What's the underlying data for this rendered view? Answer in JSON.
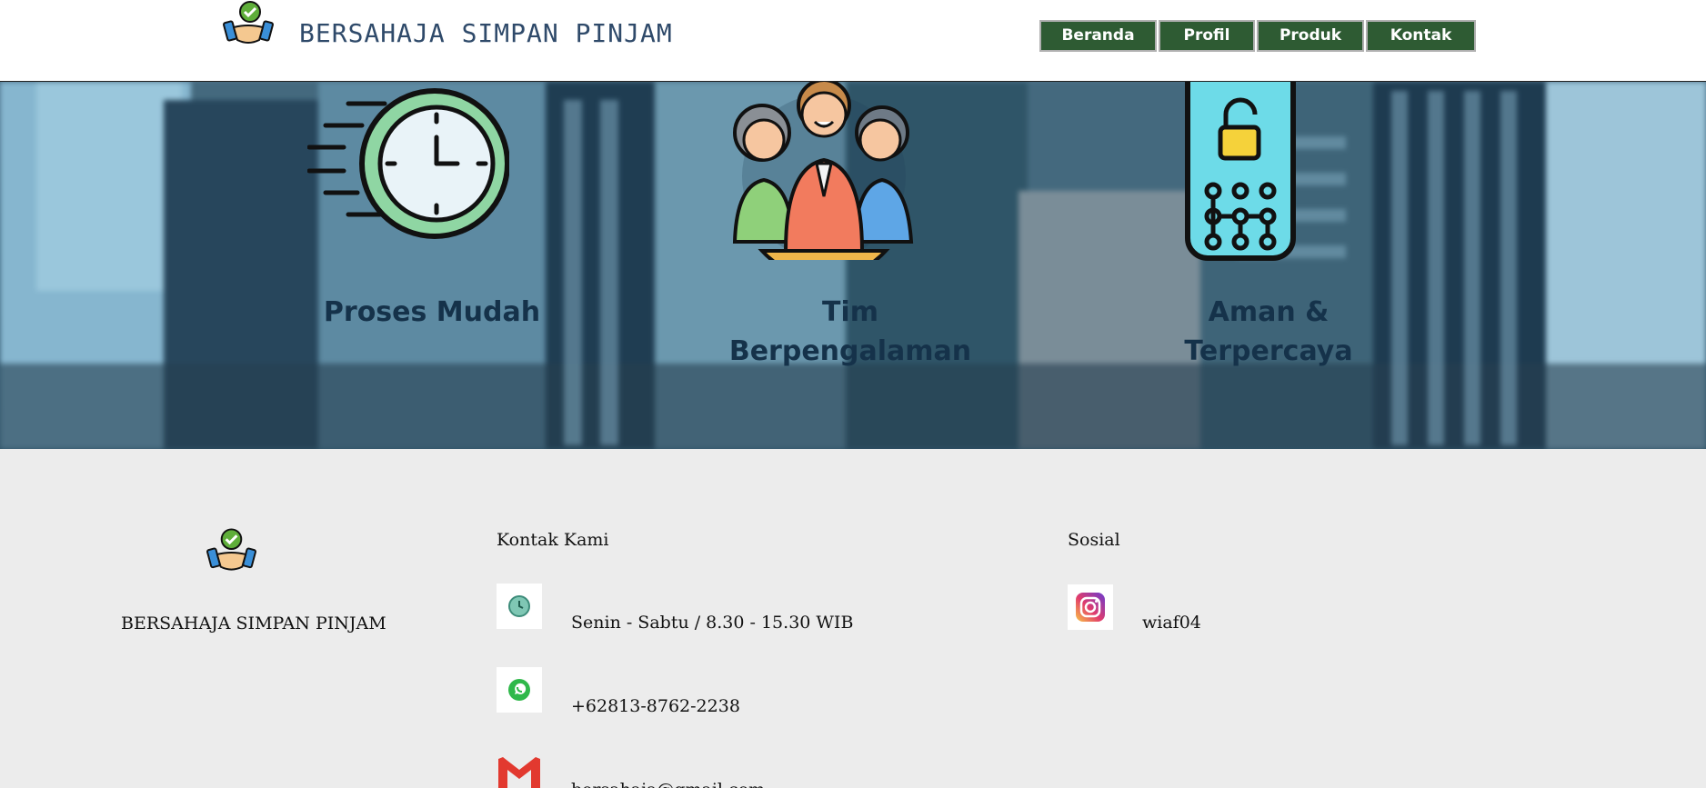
{
  "header": {
    "brand": "BERSAHAJA SIMPAN PINJAM",
    "nav": [
      {
        "label": "Beranda"
      },
      {
        "label": "Profil"
      },
      {
        "label": "Produk"
      },
      {
        "label": "Kontak"
      }
    ]
  },
  "features": [
    {
      "icon": "clock-icon",
      "line1": "Proses Mudah",
      "line2": ""
    },
    {
      "icon": "team-icon",
      "line1": "Tim",
      "line2": "Berpengalaman"
    },
    {
      "icon": "security-lock-icon",
      "line1": "Aman &",
      "line2": "Terpercaya"
    }
  ],
  "footer": {
    "brand": "BERSAHAJA SIMPAN PINJAM",
    "contact_title": "Kontak Kami",
    "contact": [
      {
        "icon": "clock-icon",
        "text": "Senin - Sabtu / 8.30 - 15.30 WIB"
      },
      {
        "icon": "whatsapp-icon",
        "text": "+62813-8762-2238"
      },
      {
        "icon": "gmail-icon",
        "text": "bersahaja@gmail.com"
      }
    ],
    "social_title": "Sosial",
    "social": [
      {
        "icon": "instagram-icon",
        "text": "wiaf04"
      }
    ]
  },
  "colors": {
    "nav_bg": "#2e5b33",
    "feature_text": "#15324a",
    "footer_bg": "#ececec"
  }
}
